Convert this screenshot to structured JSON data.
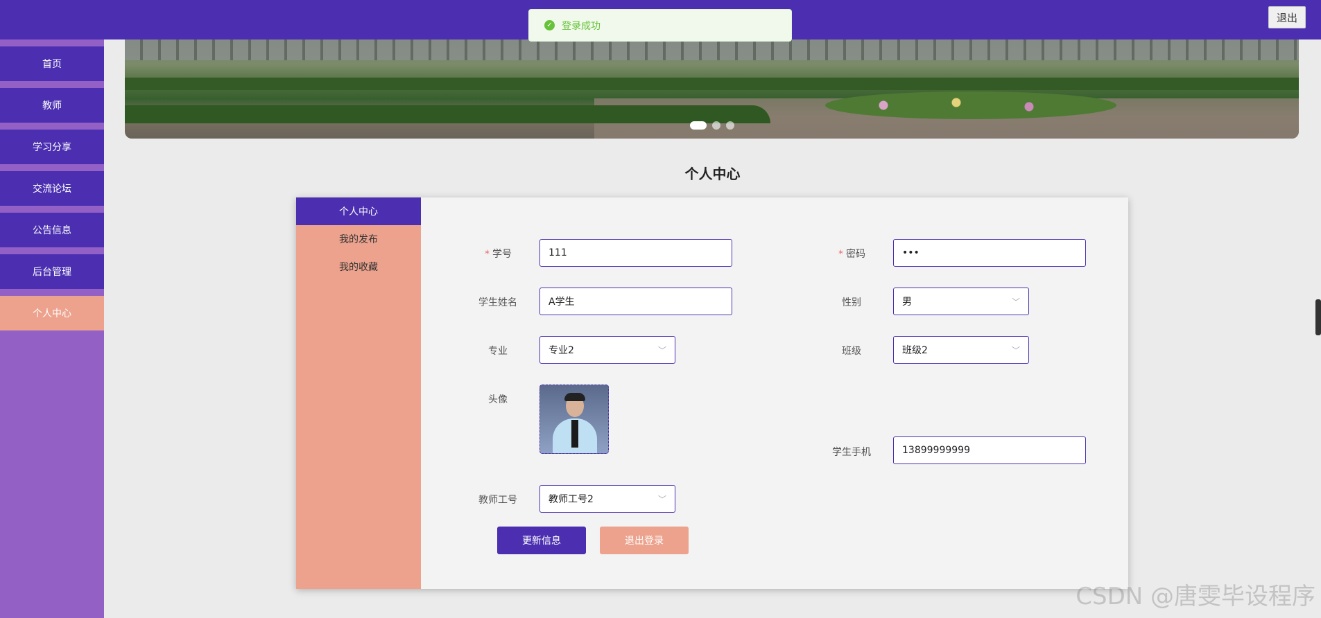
{
  "header": {
    "logout_label": "退出"
  },
  "toast": {
    "message": "登录成功",
    "icon": "check-circle-icon",
    "color": "#67c23a"
  },
  "colors": {
    "primary": "#4b2fb0",
    "accent": "#eca28d",
    "sidebar_bg": "#9360c6"
  },
  "sidebar": {
    "items": [
      {
        "label": "首页"
      },
      {
        "label": "教师"
      },
      {
        "label": "学习分享"
      },
      {
        "label": "交流论坛"
      },
      {
        "label": "公告信息"
      },
      {
        "label": "后台管理"
      },
      {
        "label": "个人中心",
        "active": true
      }
    ]
  },
  "banner": {
    "slide_count": 3,
    "active_slide": 1
  },
  "page": {
    "title": "个人中心"
  },
  "profile_menu": {
    "items": [
      {
        "label": "个人中心",
        "active": true
      },
      {
        "label": "我的发布"
      },
      {
        "label": "我的收藏"
      }
    ]
  },
  "form": {
    "student_id": {
      "label": "学号",
      "value": "111",
      "required": true
    },
    "password": {
      "label": "密码",
      "value": "•••",
      "required": true
    },
    "student_name": {
      "label": "学生姓名",
      "value": "A学生"
    },
    "gender": {
      "label": "性别",
      "value": "男"
    },
    "major": {
      "label": "专业",
      "value": "专业2"
    },
    "class": {
      "label": "班级",
      "value": "班级2"
    },
    "avatar": {
      "label": "头像"
    },
    "phone": {
      "label": "学生手机",
      "value": "13899999999"
    },
    "teacher_id": {
      "label": "教师工号",
      "value": "教师工号2"
    }
  },
  "actions": {
    "update_label": "更新信息",
    "logout_label": "退出登录"
  },
  "watermark": "CSDN @唐雯毕设程序"
}
